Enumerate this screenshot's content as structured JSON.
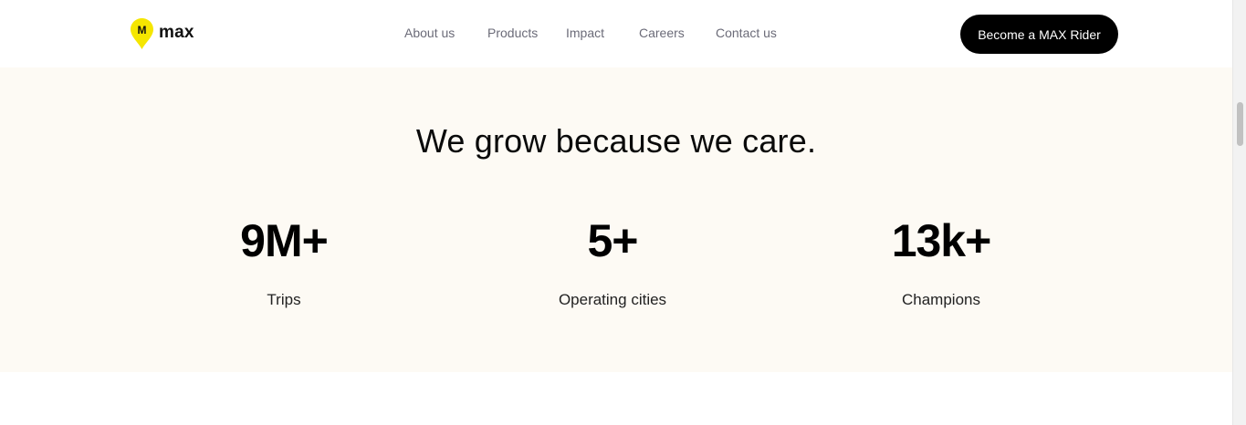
{
  "header": {
    "logo_text": "max",
    "logo_mark": "M",
    "nav": [
      {
        "label": "About us"
      },
      {
        "label": "Products"
      },
      {
        "label": "Impact"
      },
      {
        "label": "Careers"
      },
      {
        "label": "Contact us"
      }
    ],
    "cta_label": "Become a MAX Rider"
  },
  "stats": {
    "headline": "We grow because we care.",
    "items": [
      {
        "value": "9M+",
        "label": "Trips"
      },
      {
        "value": "5+",
        "label": "Operating cities"
      },
      {
        "value": "13k+",
        "label": "Champions"
      }
    ]
  },
  "colors": {
    "brand_yellow": "#f5e600",
    "stats_background": "#fdfaf4",
    "cta_background": "#000000"
  },
  "icons": [
    "map-pin-logo-icon"
  ]
}
